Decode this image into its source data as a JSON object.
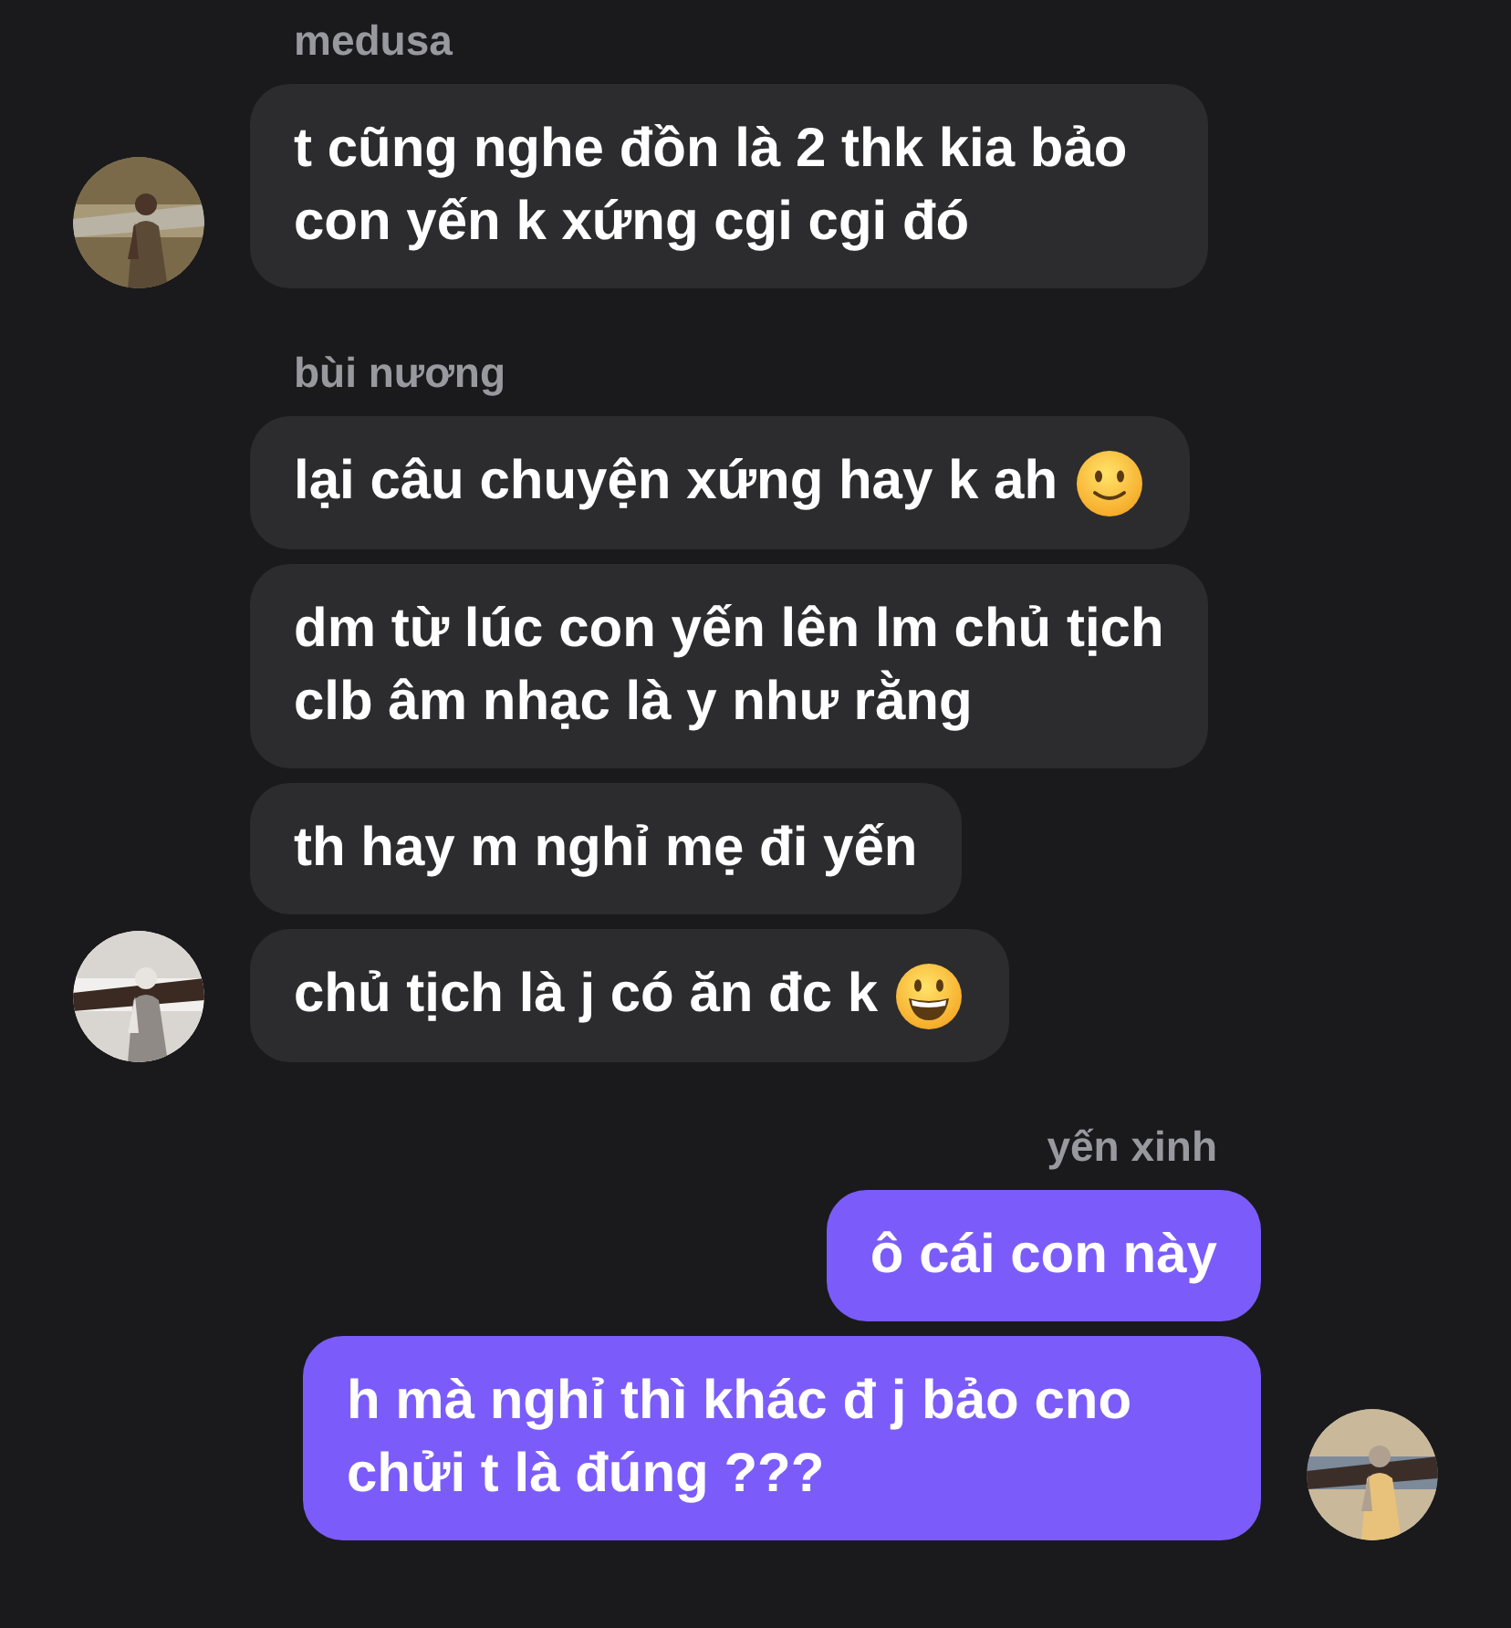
{
  "groups": [
    {
      "sender": "medusa",
      "kind": "incoming",
      "avatar": {
        "kind": "picture"
      },
      "messages": [
        {
          "kind": "plain",
          "text": "t cũng nghe đồn là 2 thk kia bảo con yến k xứng cgi cgi đó"
        }
      ]
    },
    {
      "sender": "bùi nương",
      "kind": "incoming",
      "avatar": {
        "kind": "picture"
      },
      "messages": [
        {
          "kind": "slight-smile",
          "text": "lại câu chuyện xứng hay k ah"
        },
        {
          "kind": "plain",
          "text": "dm từ lúc con yến lên lm chủ tịch clb âm nhạc là y như rằng"
        },
        {
          "kind": "plain",
          "text": "th hay m nghỉ mẹ đi yến"
        },
        {
          "kind": "grin",
          "text": "chủ tịch là j có ăn đc k"
        }
      ]
    },
    {
      "sender": "yến xinh",
      "kind": "outgoing",
      "avatar": {
        "kind": "picture"
      },
      "messages": [
        {
          "kind": "plain",
          "text": "ô cái con này"
        },
        {
          "kind": "plain",
          "text": "h mà nghỉ thì khác đ j bảo cno chửi t là đúng ???"
        }
      ]
    }
  ]
}
